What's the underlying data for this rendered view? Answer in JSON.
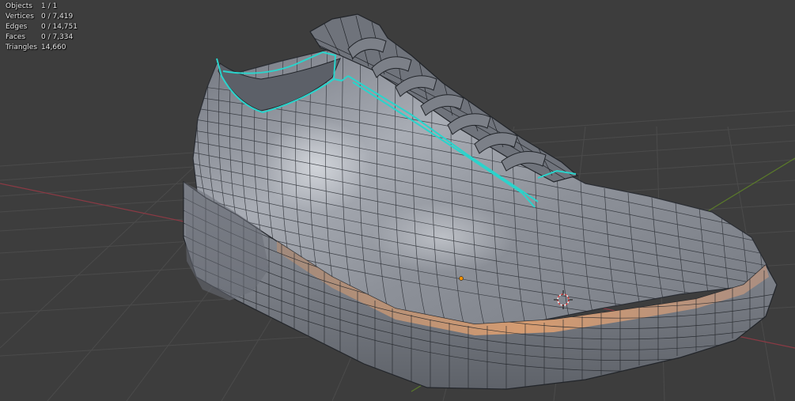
{
  "viewport": {
    "background": "#3d3d3d",
    "grid_color": "#4a4a4a",
    "x_axis_color": "#8a3a44",
    "y_axis_color": "#5a7a2a",
    "mesh_color": "#8a8f99",
    "wire_color": "#1f2228",
    "selected_edge_color": "#2ad4cc",
    "origin_color": "#f29000",
    "cursor_color": "#e04040"
  },
  "stats": {
    "objects": {
      "label": "Objects",
      "value": "1 / 1"
    },
    "vertices": {
      "label": "Vertices",
      "value": "0 / 7,419"
    },
    "edges": {
      "label": "Edges",
      "value": "0 / 14,751"
    },
    "faces": {
      "label": "Faces",
      "value": "0 / 7,334"
    },
    "triangles": {
      "label": "Triangles",
      "value": "14,660"
    }
  }
}
